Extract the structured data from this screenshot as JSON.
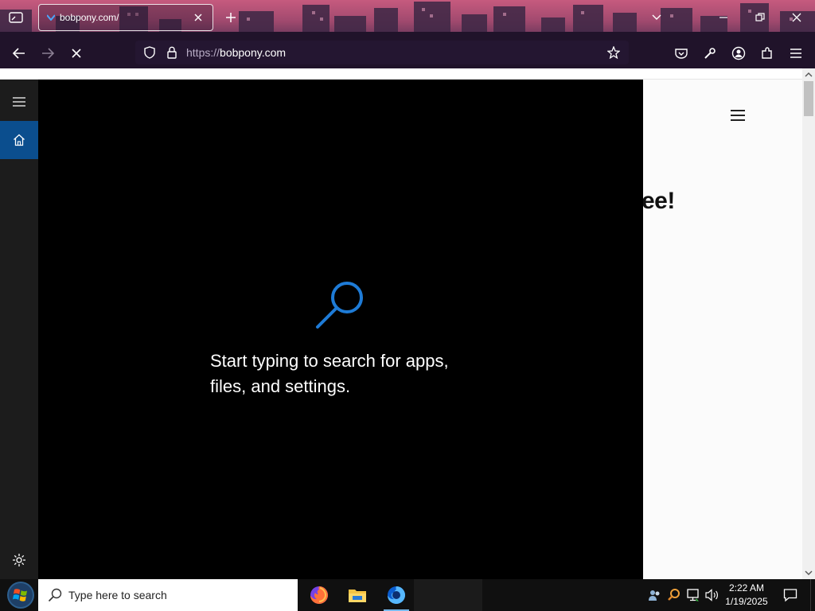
{
  "browser": {
    "tab": {
      "title": "bobpony.com/"
    },
    "url": {
      "scheme": "https://",
      "host": "bobpony.com"
    }
  },
  "page": {
    "headline_fragment": "ee!"
  },
  "search_panel": {
    "message_line1": "Start typing to search for apps,",
    "message_line2": "files, and settings."
  },
  "taskbar": {
    "search_placeholder": "Type here to search",
    "clock_time": "2:22 AM",
    "clock_date": "1/19/2025"
  },
  "colors": {
    "accent_blue": "#0b4e8e",
    "search_icon_blue": "#1e7bd6",
    "chrome_pink": "#c65a7e",
    "chrome_purple": "#2b1d36"
  },
  "icons": {
    "tab_list": "tab-list-icon",
    "close": "close-icon",
    "new_tab": "plus-icon",
    "back": "back-arrow-icon",
    "forward": "forward-arrow-icon",
    "stop": "stop-icon",
    "shield": "shield-icon",
    "lock": "lock-icon",
    "star": "star-icon",
    "pocket": "pocket-icon",
    "wrench": "wrench-icon",
    "account": "account-icon",
    "extensions": "puzzle-icon",
    "menu": "hamburger-icon",
    "home": "home-icon",
    "settings": "gear-icon",
    "search": "magnifier-icon"
  }
}
